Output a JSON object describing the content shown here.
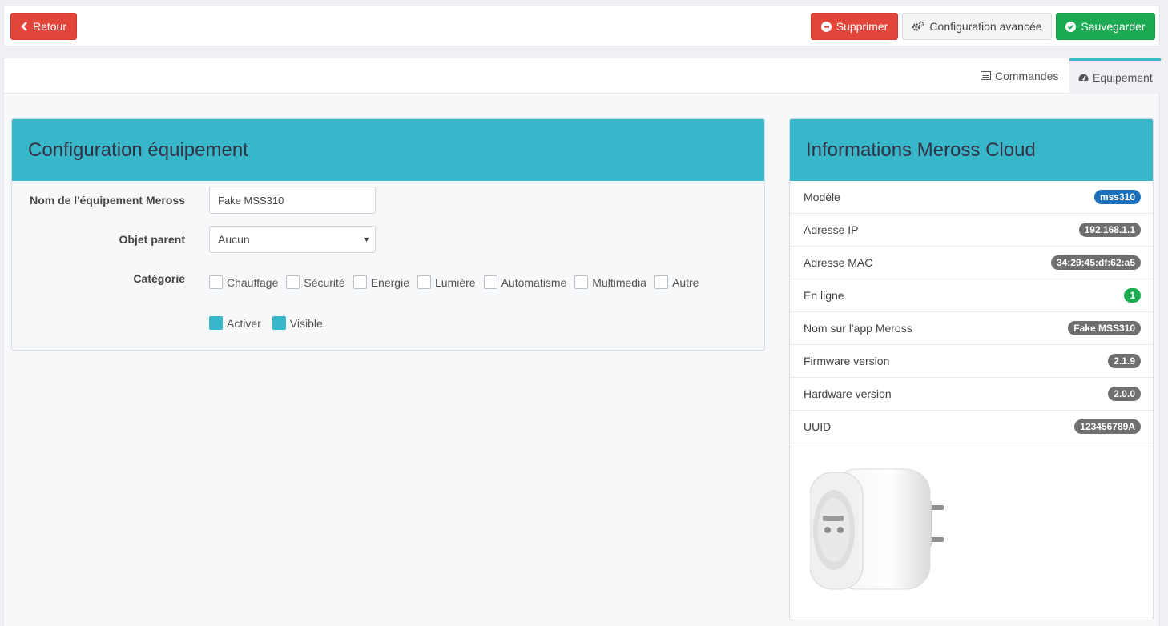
{
  "toolbar": {
    "back_label": "Retour",
    "delete_label": "Supprimer",
    "advanced_label": "Configuration avancée",
    "save_label": "Sauvegarder"
  },
  "tabs": {
    "commands_label": "Commandes",
    "equipment_label": "Equipement"
  },
  "config": {
    "title": "Configuration équipement",
    "name_label": "Nom de l'équipement Meross",
    "name_value": "Fake MSS310",
    "parent_label": "Objet parent",
    "parent_value": "Aucun",
    "category_label": "Catégorie",
    "categories": [
      "Chauffage",
      "Sécurité",
      "Energie",
      "Lumière",
      "Automatisme",
      "Multimedia",
      "Autre"
    ],
    "activate_label": "Activer",
    "visible_label": "Visible"
  },
  "info": {
    "title": "Informations Meross Cloud",
    "rows": [
      {
        "label": "Modèle",
        "value": "mss310"
      },
      {
        "label": "Adresse IP",
        "value": "192.168.1.1"
      },
      {
        "label": "Adresse MAC",
        "value": "34:29:45:df:62:a5"
      },
      {
        "label": "En ligne",
        "value": "1"
      },
      {
        "label": "Nom sur l'app Meross",
        "value": "Fake MSS310"
      },
      {
        "label": "Firmware version",
        "value": "2.1.9"
      },
      {
        "label": "Hardware version",
        "value": "2.0.0"
      },
      {
        "label": "UUID",
        "value": "123456789A"
      }
    ]
  },
  "colors": {
    "accent": "#38b6ca",
    "danger": "#e2463a",
    "success": "#1cab52",
    "badge_blue": "#1b6fb8",
    "badge_grey": "#6f6f6f"
  },
  "icons": {
    "back": "chevron-left-icon",
    "delete": "minus-circle-icon",
    "advanced": "cogs-icon",
    "save": "check-circle-icon",
    "commands": "list-icon",
    "equipment": "tachometer-icon"
  }
}
